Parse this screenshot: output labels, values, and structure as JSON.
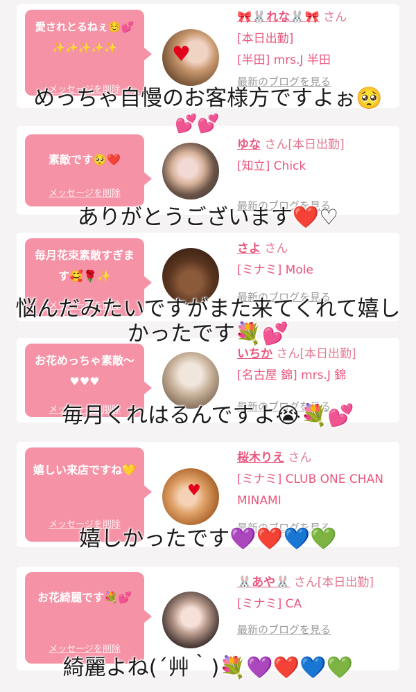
{
  "cards": [
    {
      "message": "愛されとるねぇ☺️💕✨✨✨✨✨",
      "delete_label": "メッセージを削除",
      "name": "🎀🐰れな🐰🎀",
      "san": "さん",
      "status": "",
      "shop": "[本日出勤]",
      "shop2": "[半田] mrs.J 半田",
      "blog": "最新のブログを見る"
    },
    {
      "message": "素敵です🥺❤️",
      "delete_label": "メッセージを削除",
      "name": "ゆな",
      "san": "さん[本日出勤]",
      "shop": "[知立] Chick",
      "blog": "最新のブログを見る"
    },
    {
      "message": "毎月花束素敵すぎます🥰🌹✨",
      "delete_label": "メッセージを削除",
      "name": "さよ",
      "san": "さん",
      "shop": "[ミナミ] Mole",
      "blog": "最新のブログを見る"
    },
    {
      "message": "お花めっちゃ素敵〜♥︎♥︎♥︎",
      "delete_label": "メッセージを削除",
      "name": "いちか",
      "san": "さん[本日出勤]",
      "shop": "[名古屋 錦] mrs.J 錦",
      "blog": "最新のブログを見る"
    },
    {
      "message": "嬉しい来店ですね💛",
      "delete_label": "メッセージを削除",
      "name": "桜木りえ",
      "san": "さん",
      "shop": "[ミナミ] CLUB ONE CHAN MINAMI",
      "blog": "最新のブログを見る"
    },
    {
      "message": "お花綺麗です💐💕",
      "delete_label": "メッセージを削除",
      "name": "🐰あや🐰",
      "san": "さん[本日出勤]",
      "shop": "[ミナミ] CA",
      "blog": "最新のブログを見る"
    }
  ],
  "captions": [
    "めっちゃ自慢のお客様方ですよぉ🥺",
    "ありがとうございます❤️♡",
    "悩んだみたいですがまた来てくれて嬉しかったです💐💕",
    "毎月くれはるんですよ😭💐💕",
    "嬉しかったです💜❤️💙💚",
    "綺麗よね(´艸｀)💐💜❤️💙💚"
  ],
  "floating_hearts": "💕💕"
}
